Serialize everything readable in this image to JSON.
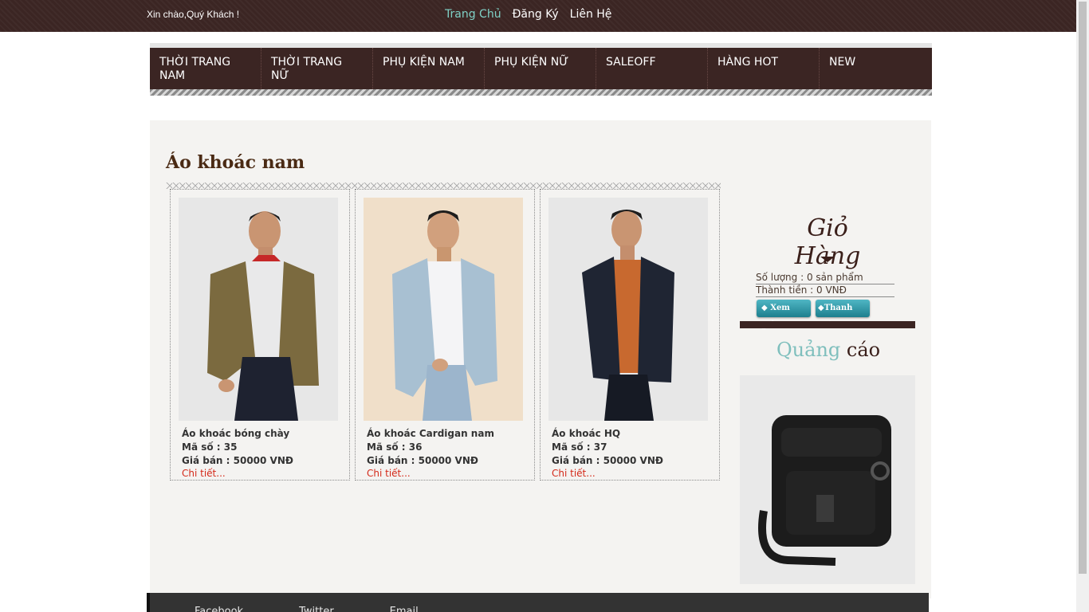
{
  "header": {
    "greeting": "Xin chào,Quý Khách !",
    "links": [
      "Trang Chủ",
      "Đăng Ký",
      "Liên Hệ"
    ]
  },
  "nav": {
    "items": [
      "THỜI TRANG NAM",
      "THỜI TRANG NỮ",
      "PHỤ KIỆN NAM",
      "PHỤ KIỆN NỮ",
      "SALEOFF",
      "HÀNG HOT",
      "NEW"
    ]
  },
  "section": {
    "title": "Áo khoác nam"
  },
  "products": [
    {
      "name": "Áo khoác bóng chày",
      "code": "Mã số : 35",
      "price": "Giá bán : 50000 VNĐ",
      "detail": "Chi tiết..."
    },
    {
      "name": "Áo khoác Cardigan nam",
      "code": "Mã số : 36",
      "price": "Giá bán : 50000 VNĐ",
      "detail": "Chi tiết..."
    },
    {
      "name": "Áo khoác HQ",
      "code": "Mã số : 37",
      "price": "Giá bán : 50000 VNĐ",
      "detail": "Chi tiết..."
    }
  ],
  "cart": {
    "title": "Giỏ Hàng",
    "quantity": "Số lượng : 0 sản phẩm",
    "total": "Thành tiền : 0 VNĐ",
    "view_button": "Xem giỏ",
    "pay_button": "Thanh toán"
  },
  "ad": {
    "title_part1": "Quảng",
    "title_part2": "cáo"
  },
  "footer": {
    "links": [
      "Facebook",
      "Twitter",
      "Email"
    ]
  },
  "colors": {
    "brand_dark": "#3b2523",
    "accent_teal": "#7fd1c6",
    "detail_red": "#d42a1a"
  }
}
